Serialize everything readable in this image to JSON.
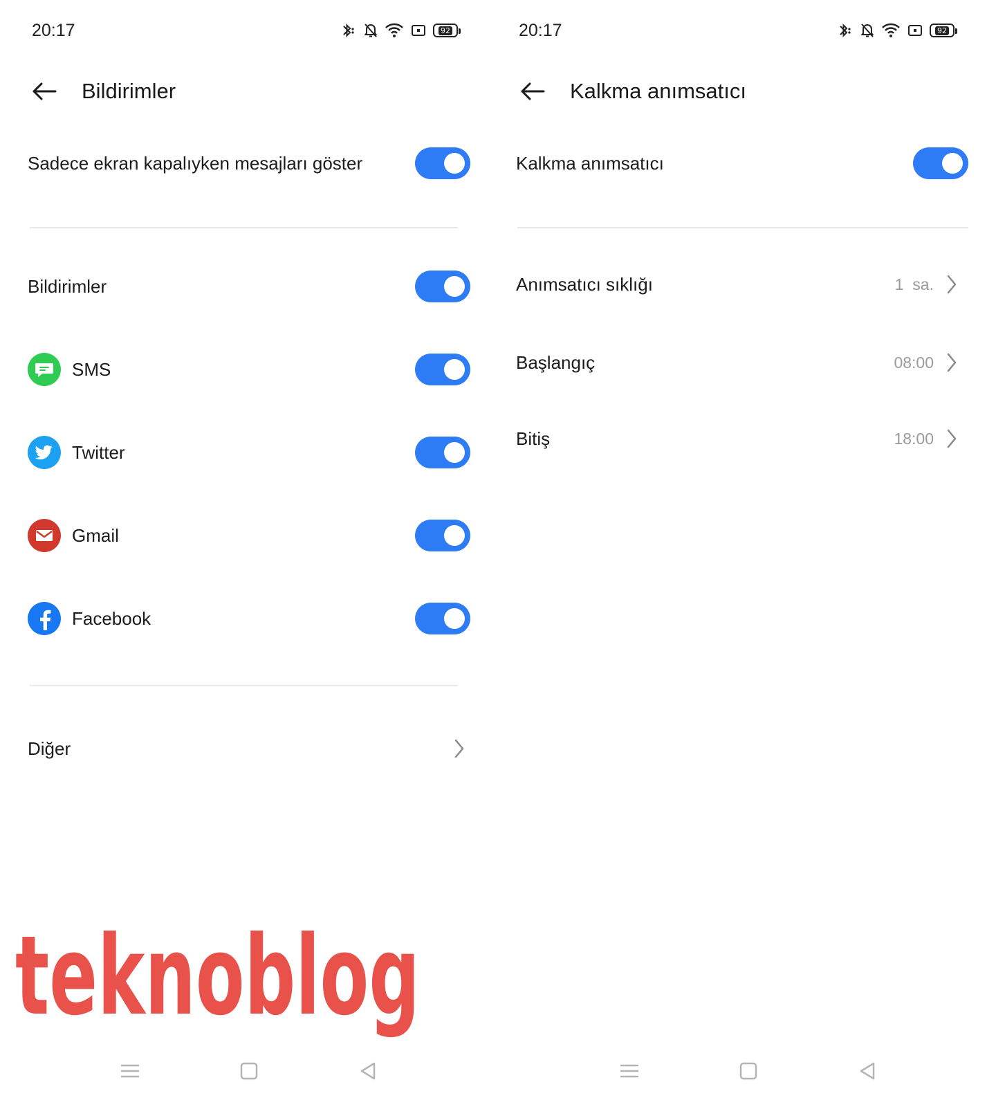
{
  "left": {
    "status": {
      "time": "20:17",
      "battery": "92"
    },
    "title": "Bildirimler",
    "show_when_off": {
      "label": "Sadece ekran kapalıyken mesajları göster",
      "enabled": true
    },
    "notifications": {
      "label": "Bildirimler",
      "enabled": true
    },
    "apps": [
      {
        "label": "SMS",
        "icon": "sms-icon",
        "enabled": true
      },
      {
        "label": "Twitter",
        "icon": "twitter-icon",
        "enabled": true
      },
      {
        "label": "Gmail",
        "icon": "gmail-icon",
        "enabled": true
      },
      {
        "label": "Facebook",
        "icon": "facebook-icon",
        "enabled": true
      }
    ],
    "other": {
      "label": "Diğer"
    }
  },
  "right": {
    "status": {
      "time": "20:17",
      "battery": "92"
    },
    "title": "Kalkma anımsatıcı",
    "reminder": {
      "label": "Kalkma anımsatıcı",
      "enabled": true
    },
    "frequency": {
      "label": "Anımsatıcı sıklığı",
      "value": "1  sa."
    },
    "start": {
      "label": "Başlangıç",
      "value": "08:00"
    },
    "end": {
      "label": "Bitiş",
      "value": "18:00"
    }
  },
  "watermark": {
    "text": "teknoblog"
  },
  "colors": {
    "accent": "#2d7cf6",
    "watermark": "#e8524a",
    "sms": "#2ecc52",
    "twitter": "#1da1f2",
    "gmail": "#d0392c",
    "facebook": "#1877f2"
  }
}
